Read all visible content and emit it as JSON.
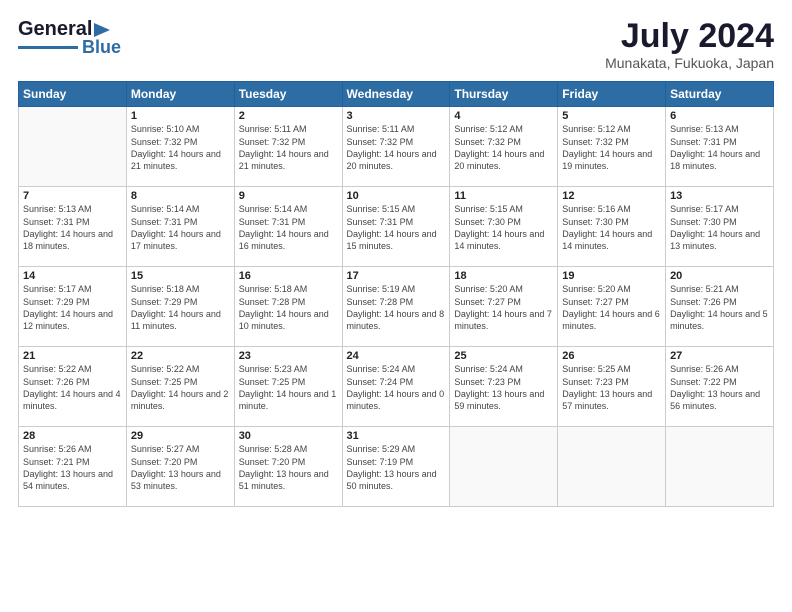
{
  "header": {
    "logo_line1": "General",
    "logo_line2": "Blue",
    "month_year": "July 2024",
    "location": "Munakata, Fukuoka, Japan"
  },
  "days_of_week": [
    "Sunday",
    "Monday",
    "Tuesday",
    "Wednesday",
    "Thursday",
    "Friday",
    "Saturday"
  ],
  "weeks": [
    [
      {
        "day": "",
        "empty": true
      },
      {
        "day": "1",
        "sunrise": "5:10 AM",
        "sunset": "7:32 PM",
        "daylight": "14 hours and 21 minutes."
      },
      {
        "day": "2",
        "sunrise": "5:11 AM",
        "sunset": "7:32 PM",
        "daylight": "14 hours and 21 minutes."
      },
      {
        "day": "3",
        "sunrise": "5:11 AM",
        "sunset": "7:32 PM",
        "daylight": "14 hours and 20 minutes."
      },
      {
        "day": "4",
        "sunrise": "5:12 AM",
        "sunset": "7:32 PM",
        "daylight": "14 hours and 20 minutes."
      },
      {
        "day": "5",
        "sunrise": "5:12 AM",
        "sunset": "7:32 PM",
        "daylight": "14 hours and 19 minutes."
      },
      {
        "day": "6",
        "sunrise": "5:13 AM",
        "sunset": "7:31 PM",
        "daylight": "14 hours and 18 minutes."
      }
    ],
    [
      {
        "day": "7",
        "sunrise": "5:13 AM",
        "sunset": "7:31 PM",
        "daylight": "14 hours and 18 minutes."
      },
      {
        "day": "8",
        "sunrise": "5:14 AM",
        "sunset": "7:31 PM",
        "daylight": "14 hours and 17 minutes."
      },
      {
        "day": "9",
        "sunrise": "5:14 AM",
        "sunset": "7:31 PM",
        "daylight": "14 hours and 16 minutes."
      },
      {
        "day": "10",
        "sunrise": "5:15 AM",
        "sunset": "7:31 PM",
        "daylight": "14 hours and 15 minutes."
      },
      {
        "day": "11",
        "sunrise": "5:15 AM",
        "sunset": "7:30 PM",
        "daylight": "14 hours and 14 minutes."
      },
      {
        "day": "12",
        "sunrise": "5:16 AM",
        "sunset": "7:30 PM",
        "daylight": "14 hours and 14 minutes."
      },
      {
        "day": "13",
        "sunrise": "5:17 AM",
        "sunset": "7:30 PM",
        "daylight": "14 hours and 13 minutes."
      }
    ],
    [
      {
        "day": "14",
        "sunrise": "5:17 AM",
        "sunset": "7:29 PM",
        "daylight": "14 hours and 12 minutes."
      },
      {
        "day": "15",
        "sunrise": "5:18 AM",
        "sunset": "7:29 PM",
        "daylight": "14 hours and 11 minutes."
      },
      {
        "day": "16",
        "sunrise": "5:18 AM",
        "sunset": "7:28 PM",
        "daylight": "14 hours and 10 minutes."
      },
      {
        "day": "17",
        "sunrise": "5:19 AM",
        "sunset": "7:28 PM",
        "daylight": "14 hours and 8 minutes."
      },
      {
        "day": "18",
        "sunrise": "5:20 AM",
        "sunset": "7:27 PM",
        "daylight": "14 hours and 7 minutes."
      },
      {
        "day": "19",
        "sunrise": "5:20 AM",
        "sunset": "7:27 PM",
        "daylight": "14 hours and 6 minutes."
      },
      {
        "day": "20",
        "sunrise": "5:21 AM",
        "sunset": "7:26 PM",
        "daylight": "14 hours and 5 minutes."
      }
    ],
    [
      {
        "day": "21",
        "sunrise": "5:22 AM",
        "sunset": "7:26 PM",
        "daylight": "14 hours and 4 minutes."
      },
      {
        "day": "22",
        "sunrise": "5:22 AM",
        "sunset": "7:25 PM",
        "daylight": "14 hours and 2 minutes."
      },
      {
        "day": "23",
        "sunrise": "5:23 AM",
        "sunset": "7:25 PM",
        "daylight": "14 hours and 1 minute."
      },
      {
        "day": "24",
        "sunrise": "5:24 AM",
        "sunset": "7:24 PM",
        "daylight": "14 hours and 0 minutes."
      },
      {
        "day": "25",
        "sunrise": "5:24 AM",
        "sunset": "7:23 PM",
        "daylight": "13 hours and 59 minutes."
      },
      {
        "day": "26",
        "sunrise": "5:25 AM",
        "sunset": "7:23 PM",
        "daylight": "13 hours and 57 minutes."
      },
      {
        "day": "27",
        "sunrise": "5:26 AM",
        "sunset": "7:22 PM",
        "daylight": "13 hours and 56 minutes."
      }
    ],
    [
      {
        "day": "28",
        "sunrise": "5:26 AM",
        "sunset": "7:21 PM",
        "daylight": "13 hours and 54 minutes."
      },
      {
        "day": "29",
        "sunrise": "5:27 AM",
        "sunset": "7:20 PM",
        "daylight": "13 hours and 53 minutes."
      },
      {
        "day": "30",
        "sunrise": "5:28 AM",
        "sunset": "7:20 PM",
        "daylight": "13 hours and 51 minutes."
      },
      {
        "day": "31",
        "sunrise": "5:29 AM",
        "sunset": "7:19 PM",
        "daylight": "13 hours and 50 minutes."
      },
      {
        "day": "",
        "empty": true
      },
      {
        "day": "",
        "empty": true
      },
      {
        "day": "",
        "empty": true
      }
    ]
  ]
}
